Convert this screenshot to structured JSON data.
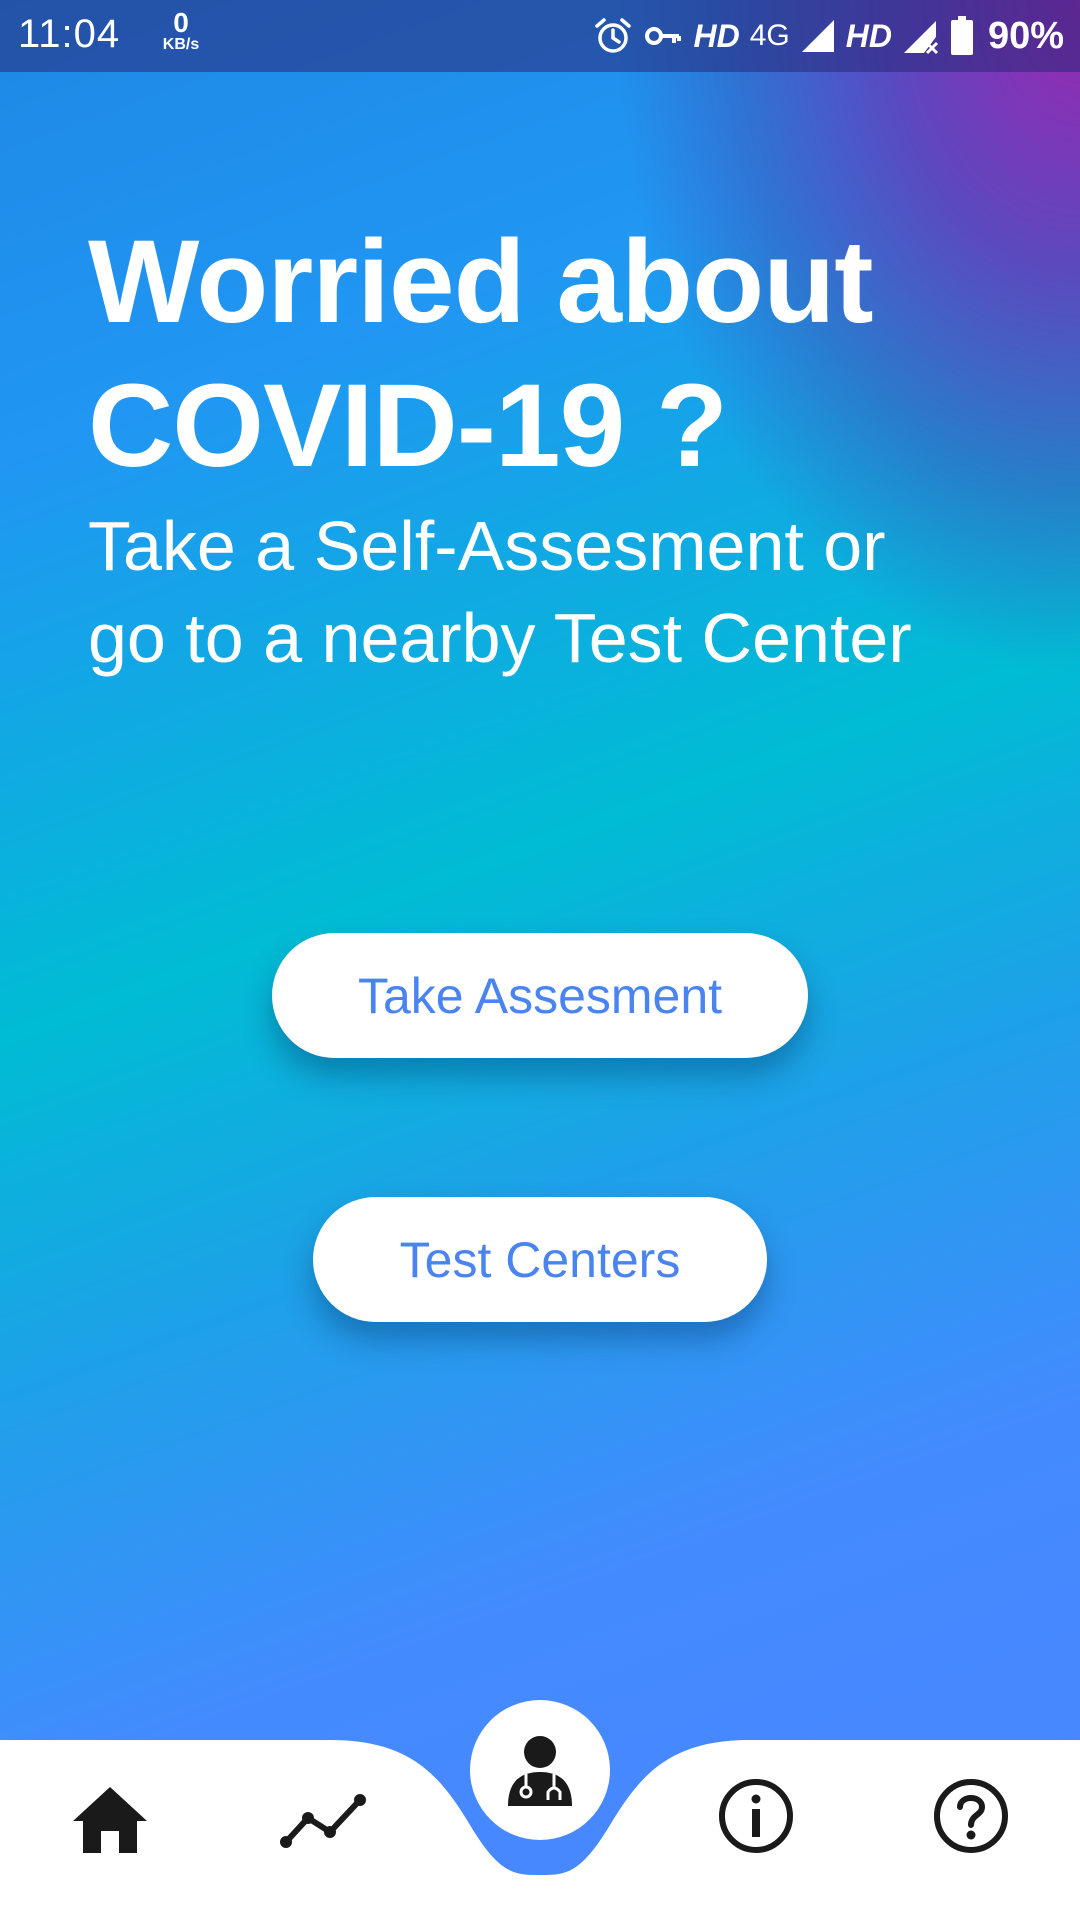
{
  "status_bar": {
    "time": "11:04",
    "net_speed_value": "0",
    "net_speed_unit": "KB/s",
    "hd1": "HD",
    "net_type": "4G",
    "hd2": "HD",
    "battery": "90%"
  },
  "hero": {
    "headline_line1": "Worried about",
    "headline_line2": "COVID-19 ?",
    "subtitle_line1": "Take a Self-Assesment or",
    "subtitle_line2": "go to a nearby Test Center"
  },
  "actions": {
    "assessment_label": "Take Assesment",
    "test_centers_label": "Test Centers"
  },
  "bottom_nav": {
    "items": [
      {
        "icon": "home-icon"
      },
      {
        "icon": "trending-icon"
      },
      {
        "icon": "doctor-icon",
        "active": true
      },
      {
        "icon": "info-icon"
      },
      {
        "icon": "help-icon"
      }
    ]
  },
  "colors": {
    "accent_blue": "#4a84f0",
    "active_nav_notch": "#448aff"
  }
}
